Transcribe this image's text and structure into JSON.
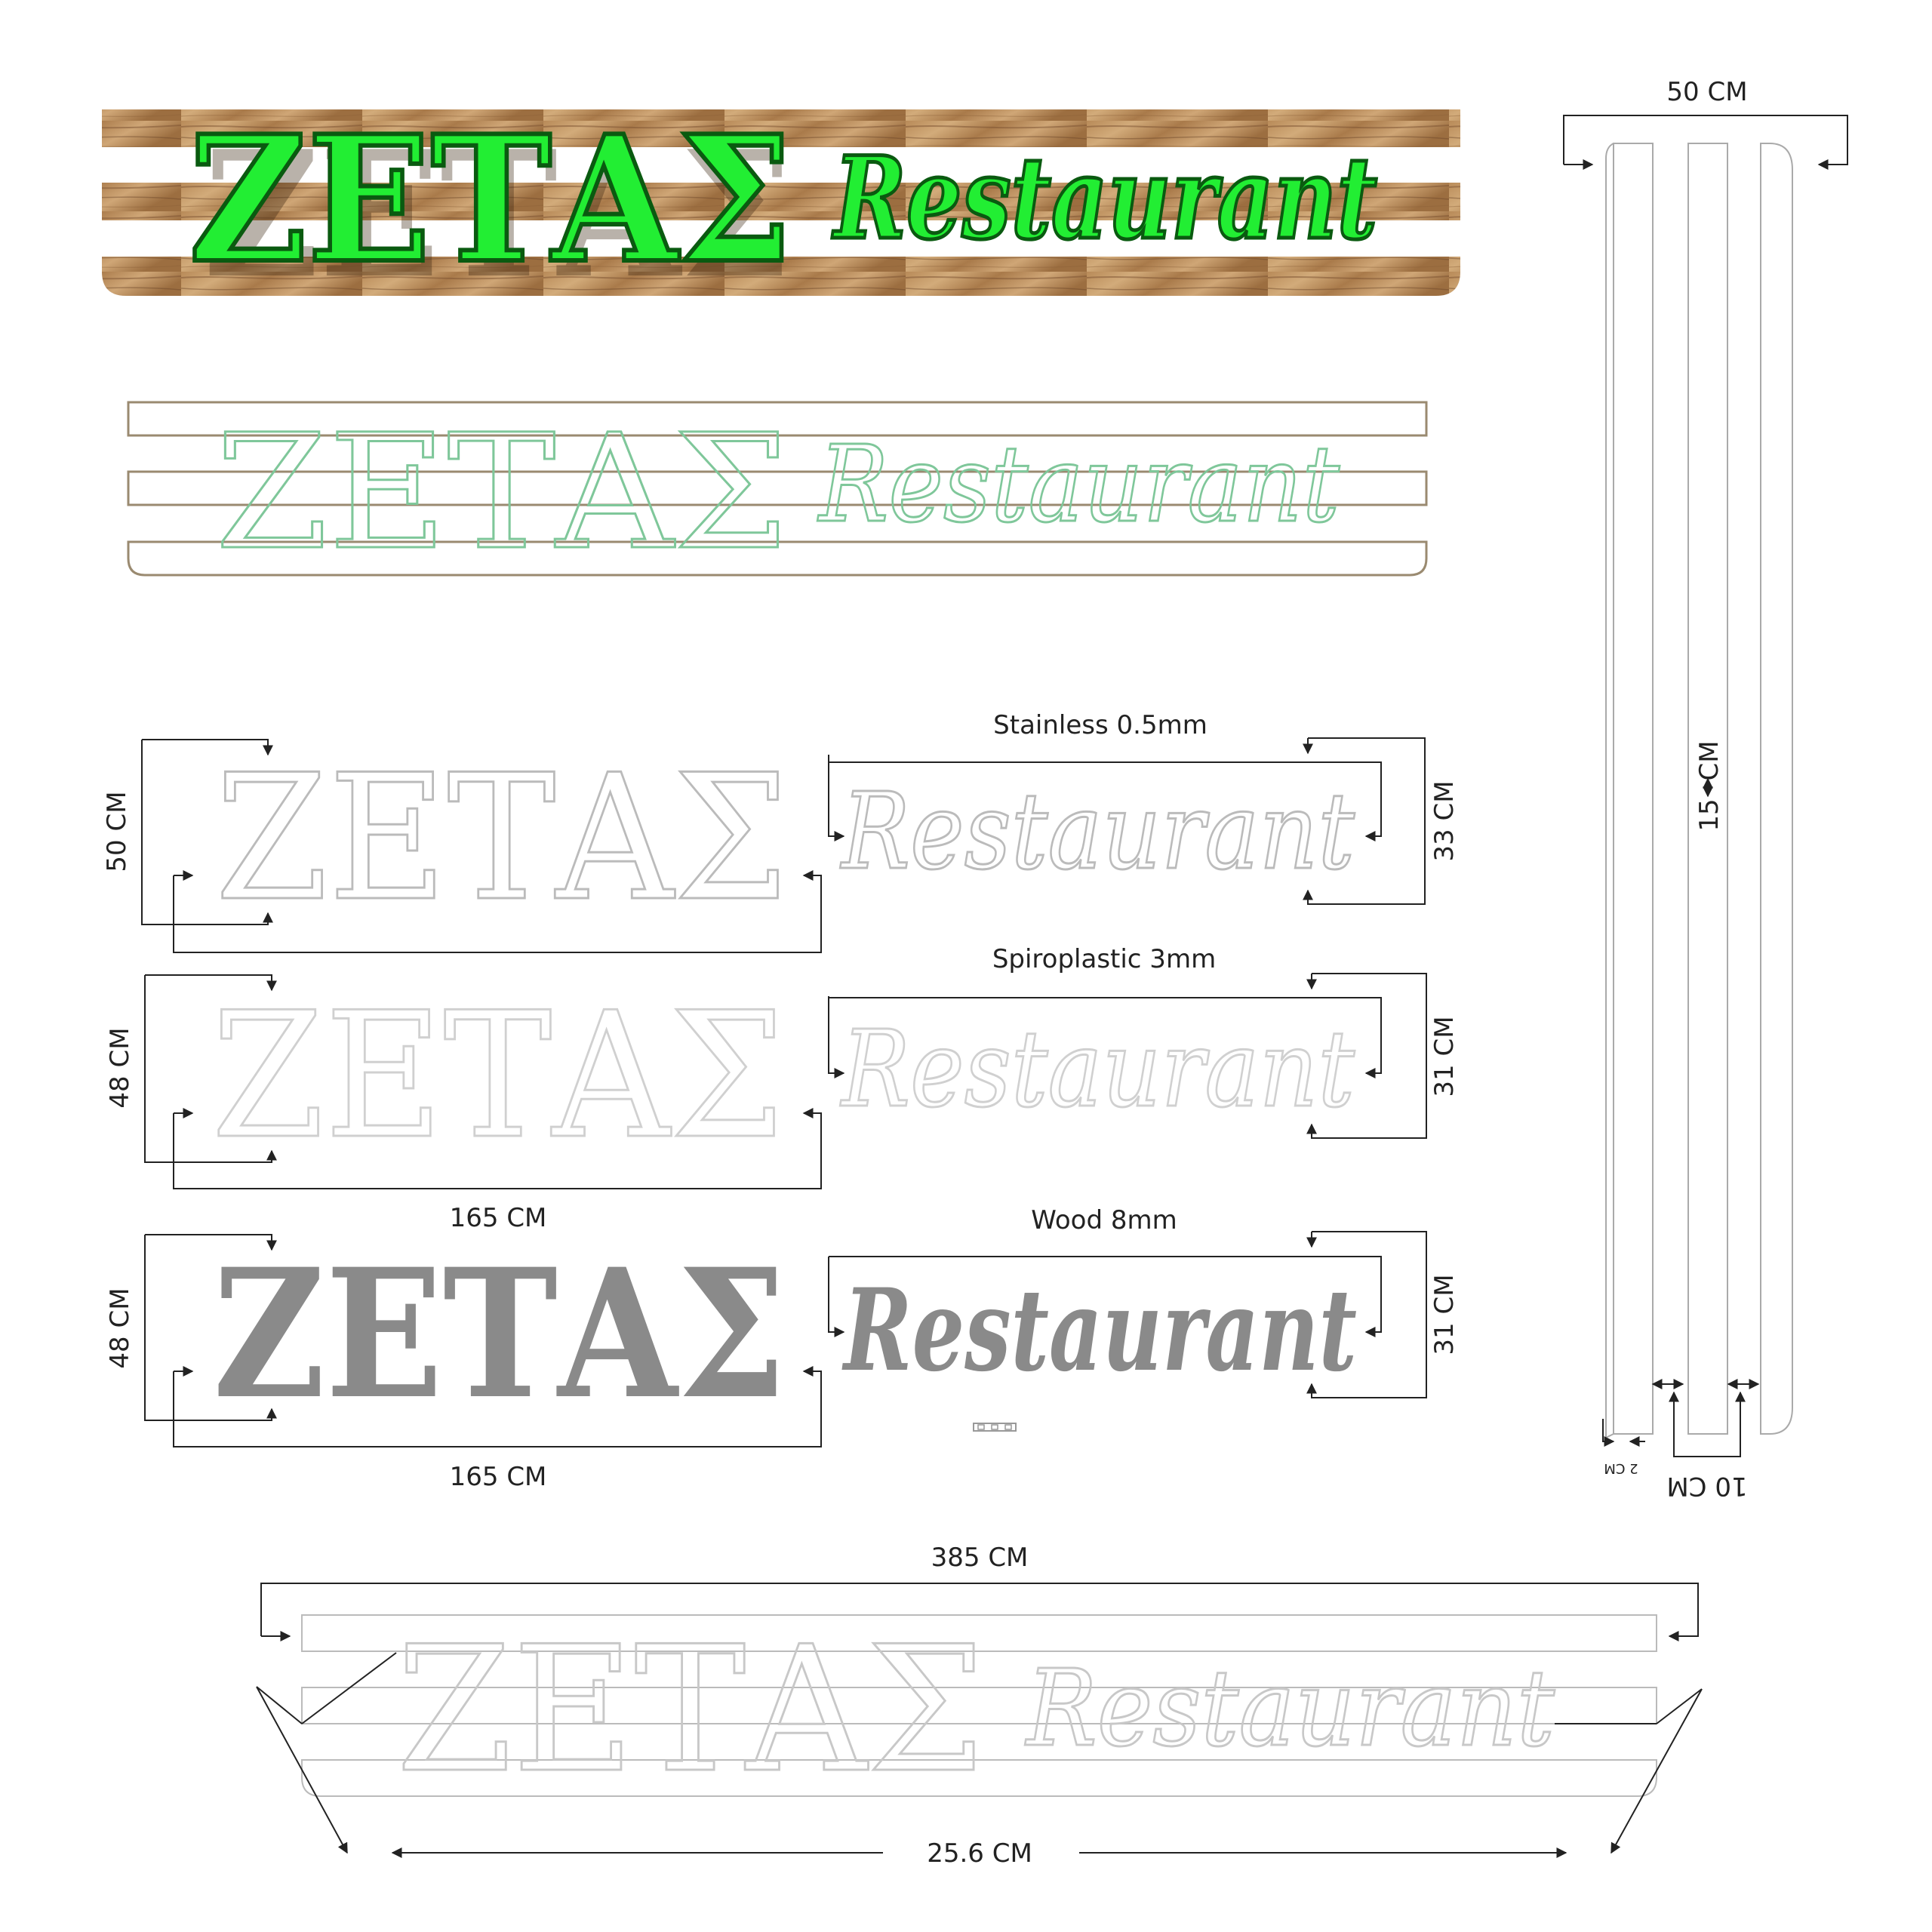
{
  "sign": {
    "word1": "ΖΕΤΑΣ",
    "word2": "Restaurant"
  },
  "colors": {
    "green_fill": "#22ee33",
    "green_dark": "#0a7a14",
    "wood_light": "#c8a070",
    "wood_dark": "#8a6038",
    "line": "#9a9a9a",
    "outline_green": "#7fc79a",
    "solid_grey": "#8a8a8a",
    "dim": "#222222"
  },
  "dimensions": {
    "panel_width_top": "50 CM",
    "slat_height": "15",
    "slat_unit": "CM",
    "gap_small": "2 CM",
    "gap_large": "10 CM",
    "material_1": "Stainless  0.5mm",
    "material_2": "Spiroplastic  3mm",
    "material_3": "Wood   8mm",
    "h1": "50 CM",
    "h2": "48 CM",
    "h3": "48 CM",
    "r1": "33 CM",
    "r2": "31 CM",
    "r3": "31 CM",
    "w1": "165 CM",
    "w2": "165 CM",
    "total_width": "385 CM",
    "inner_width": "25.6 CM"
  }
}
